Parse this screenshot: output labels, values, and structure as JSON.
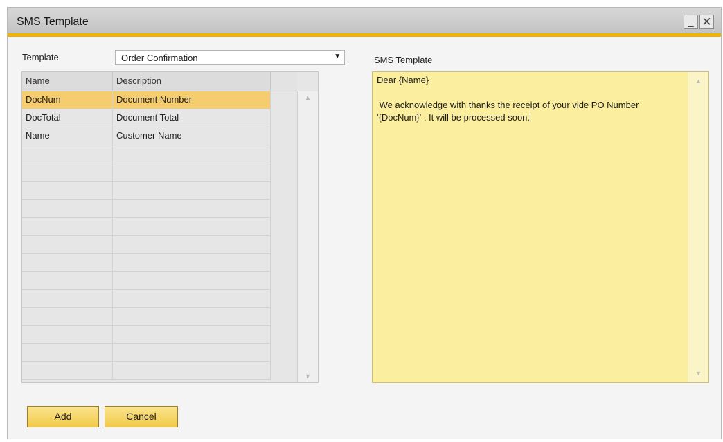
{
  "window": {
    "title": "SMS Template",
    "minimize_glyph": "_",
    "close_glyph": "✕"
  },
  "template_field": {
    "label": "Template",
    "value": "Order Confirmation",
    "arrow": "▼"
  },
  "grid": {
    "columns": [
      "Name",
      "Description"
    ],
    "rows": [
      {
        "name": "DocNum",
        "description": "Document Number",
        "selected": true
      },
      {
        "name": "DocTotal",
        "description": "Document Total"
      },
      {
        "name": "Name",
        "description": "Customer Name"
      },
      {
        "name": "",
        "description": ""
      },
      {
        "name": "",
        "description": ""
      },
      {
        "name": "",
        "description": ""
      },
      {
        "name": "",
        "description": ""
      },
      {
        "name": "",
        "description": ""
      },
      {
        "name": "",
        "description": ""
      },
      {
        "name": "",
        "description": ""
      },
      {
        "name": "",
        "description": ""
      },
      {
        "name": "",
        "description": ""
      },
      {
        "name": "",
        "description": ""
      },
      {
        "name": "",
        "description": ""
      },
      {
        "name": "",
        "description": ""
      },
      {
        "name": "",
        "description": ""
      }
    ],
    "scroll_up": "▲",
    "scroll_down": "▼"
  },
  "sms_template": {
    "label": "SMS Template",
    "text": "Dear {Name}\n\n We acknowledge with thanks the receipt of your vide PO Number '{DocNum}' . It will be processed soon.",
    "scroll_up": "▲",
    "scroll_down": "▼"
  },
  "buttons": {
    "add": "Add",
    "cancel": "Cancel"
  },
  "colors": {
    "accent": "#f0b400",
    "selected_row": "#f5cc6e",
    "editor_bg": "#fbee9e"
  }
}
